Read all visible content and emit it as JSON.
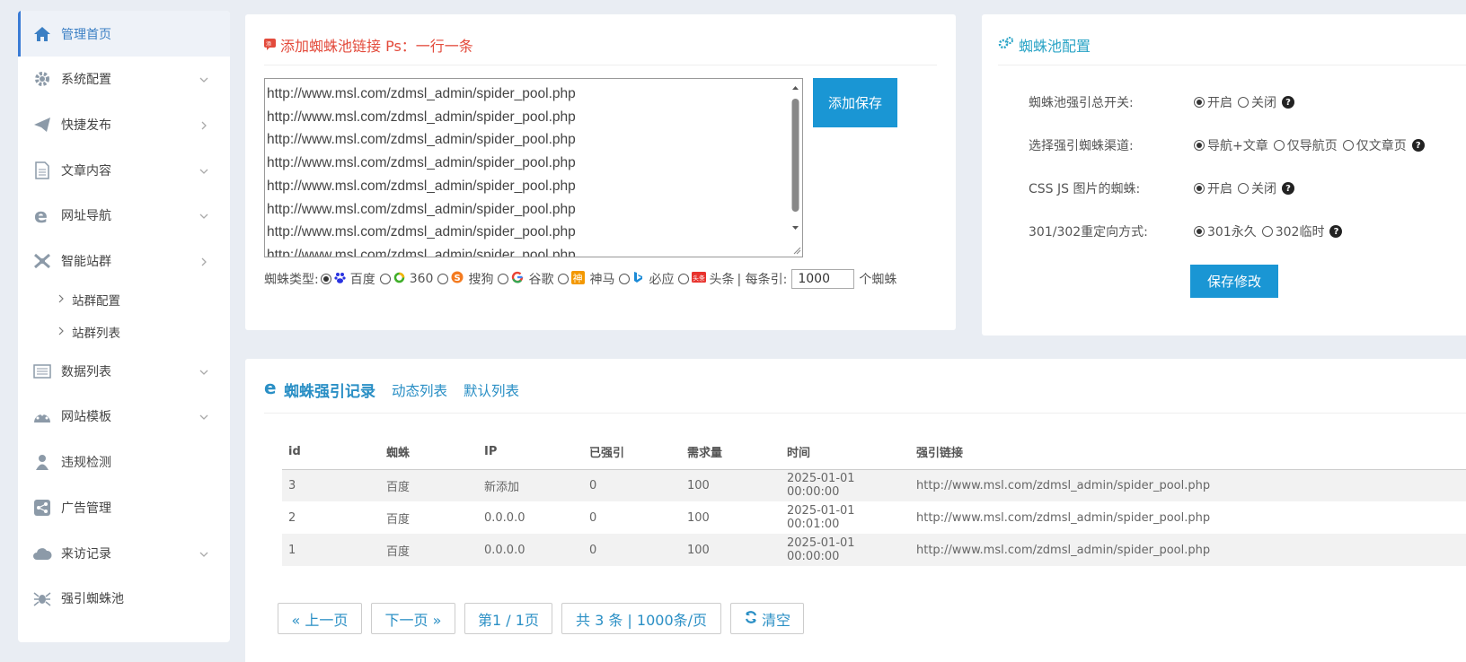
{
  "sidebar": {
    "items": [
      {
        "label": "管理首页",
        "icon": "home-icon"
      },
      {
        "label": "系统配置",
        "icon": "gear-icon"
      },
      {
        "label": "快捷发布",
        "icon": "paper-plane-icon"
      },
      {
        "label": "文章内容",
        "icon": "document-icon"
      },
      {
        "label": "网址导航",
        "icon": "ie-icon"
      },
      {
        "label": "智能站群",
        "icon": "sitegroup-icon"
      },
      {
        "label": "数据列表",
        "icon": "list-icon"
      },
      {
        "label": "网站模板",
        "icon": "palette-icon"
      },
      {
        "label": "违规检测",
        "icon": "detect-icon"
      },
      {
        "label": "广告管理",
        "icon": "share-icon"
      },
      {
        "label": "来访记录",
        "icon": "cloud-icon"
      },
      {
        "label": "强引蜘蛛池",
        "icon": "spider-icon"
      }
    ],
    "sub_items": [
      "站群配置",
      "站群列表"
    ]
  },
  "add_panel": {
    "title": "添加蜘蛛池链接 Ps：一行一条",
    "links": "http://www.msl.com/zdmsl_admin/spider_pool.php\nhttp://www.msl.com/zdmsl_admin/spider_pool.php\nhttp://www.msl.com/zdmsl_admin/spider_pool.php\nhttp://www.msl.com/zdmsl_admin/spider_pool.php\nhttp://www.msl.com/zdmsl_admin/spider_pool.php\nhttp://www.msl.com/zdmsl_admin/spider_pool.php\nhttp://www.msl.com/zdmsl_admin/spider_pool.php\nhttp://www.msl.com/zdmsl_admin/spider_pool.php",
    "save_label": "添加保存",
    "type_label": "蜘蛛类型:",
    "types": [
      "百度",
      "360",
      "搜狗",
      "谷歌",
      "神马",
      "必应",
      "头条"
    ],
    "per_label": "| 每条引:",
    "per_value": "1000",
    "per_unit": "个蜘蛛",
    "colors": {
      "title": "#e34b3c",
      "button": "#1a96d4"
    }
  },
  "config_panel": {
    "title": "蜘蛛池配置",
    "rows": [
      {
        "label": "蜘蛛池强引总开关:",
        "options": [
          "开启",
          "关闭"
        ]
      },
      {
        "label": "选择强引蜘蛛渠道:",
        "options": [
          "导航+文章",
          "仅导航页",
          "仅文章页"
        ]
      },
      {
        "label": "CSS JS 图片的蜘蛛:",
        "options": [
          "开启",
          "关闭"
        ]
      },
      {
        "label": "301/302重定向方式:",
        "options": [
          "301永久",
          "302临时"
        ]
      }
    ],
    "save_label": "保存修改"
  },
  "log_panel": {
    "title": "蜘蛛强引记录",
    "tab_dynamic": "动态列表",
    "tab_default": "默认列表",
    "columns": [
      "id",
      "蜘蛛",
      "IP",
      "已强引",
      "需求量",
      "时间",
      "强引链接"
    ],
    "rows": [
      [
        "3",
        "百度",
        "新添加",
        "0",
        "100",
        "2025-01-01 00:00:00",
        "http://www.msl.com/zdmsl_admin/spider_pool.php"
      ],
      [
        "2",
        "百度",
        "0.0.0.0",
        "0",
        "100",
        "2025-01-01 00:01:00",
        "http://www.msl.com/zdmsl_admin/spider_pool.php"
      ],
      [
        "1",
        "百度",
        "0.0.0.0",
        "0",
        "100",
        "2025-01-01 00:00:00",
        "http://www.msl.com/zdmsl_admin/spider_pool.php"
      ]
    ],
    "pager": {
      "prev": "« 上一页",
      "next": "下一页 »",
      "page": "第1 / 1页",
      "total": "共 3 条 | 1000条/页",
      "clear": "清空"
    }
  }
}
